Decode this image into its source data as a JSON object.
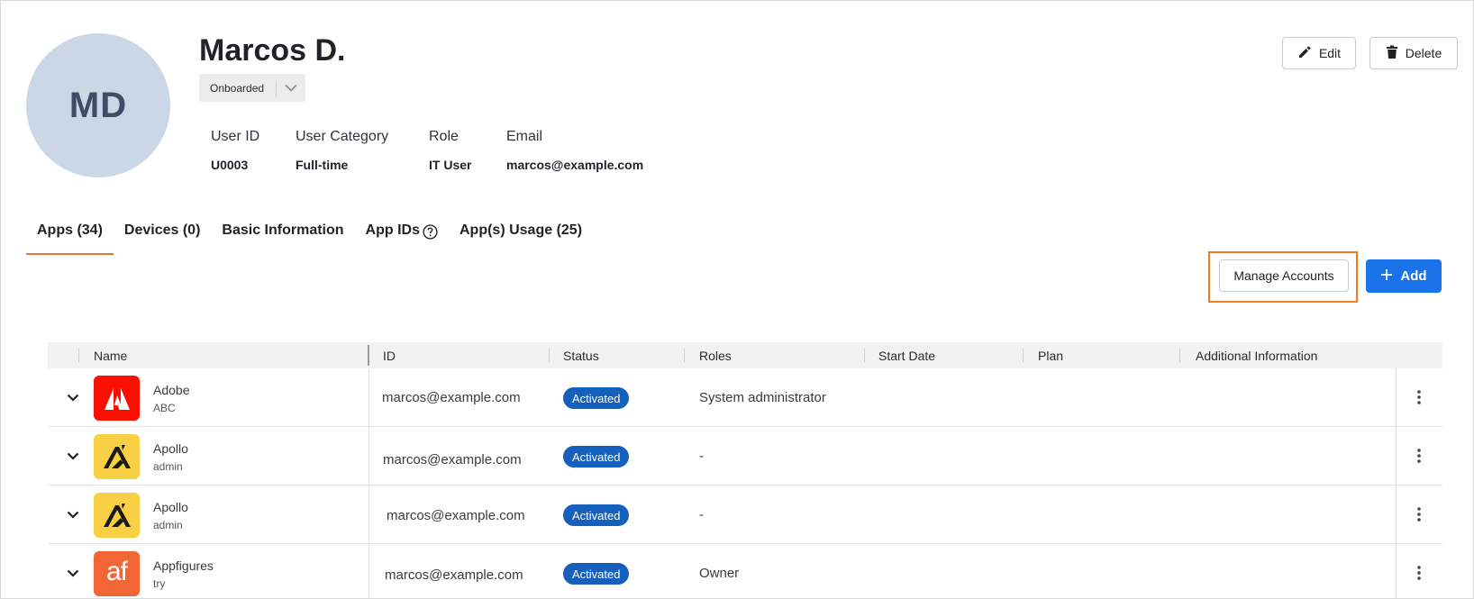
{
  "user": {
    "initials": "MD",
    "name": "Marcos D.",
    "status": "Onboarded",
    "fields": [
      {
        "label": "User ID",
        "value": "U0003"
      },
      {
        "label": "User Category",
        "value": "Full-time"
      },
      {
        "label": "Role",
        "value": "IT User"
      },
      {
        "label": "Email",
        "value": "marcos@example.com"
      }
    ]
  },
  "actions": {
    "edit": "Edit",
    "delete": "Delete"
  },
  "tabs": [
    {
      "label": "Apps (34)",
      "active": true
    },
    {
      "label": "Devices (0)"
    },
    {
      "label": "Basic Information"
    },
    {
      "label": "App IDs",
      "help_icon": "question-circle-icon"
    },
    {
      "label": "App(s) Usage (25)"
    }
  ],
  "toolbar": {
    "manage_accounts": "Manage Accounts",
    "add": "Add"
  },
  "table": {
    "columns": [
      "Name",
      "ID",
      "Status",
      "Roles",
      "Start Date",
      "Plan",
      "Additional Information"
    ],
    "rows": [
      {
        "name": "Adobe",
        "sub": "ABC",
        "id": "marcos@example.com",
        "status": "Activated",
        "roles": "System administrator",
        "logo": "adobe-logo",
        "logo_bg": "#fa0f00"
      },
      {
        "name": "Apollo",
        "sub": "admin",
        "id": "marcos@example.com",
        "status": "Activated",
        "roles": "-",
        "logo": "apollo-logo",
        "logo_bg": "#f9cf43"
      },
      {
        "name": "Apollo",
        "sub": "admin",
        "id": "marcos@example.com",
        "status": "Activated",
        "roles": "-",
        "logo": "apollo-logo",
        "logo_bg": "#f9cf43"
      },
      {
        "name": "Appfigures",
        "sub": "try",
        "id": "marcos@example.com",
        "status": "Activated",
        "roles": "Owner",
        "logo": "appfigures-logo",
        "logo_bg": "#f26534",
        "logo_text": "af"
      }
    ]
  },
  "colors": {
    "accent": "#e8743b",
    "primary": "#1a73e8",
    "badge": "#1560bd",
    "highlight": "#f07c21"
  }
}
